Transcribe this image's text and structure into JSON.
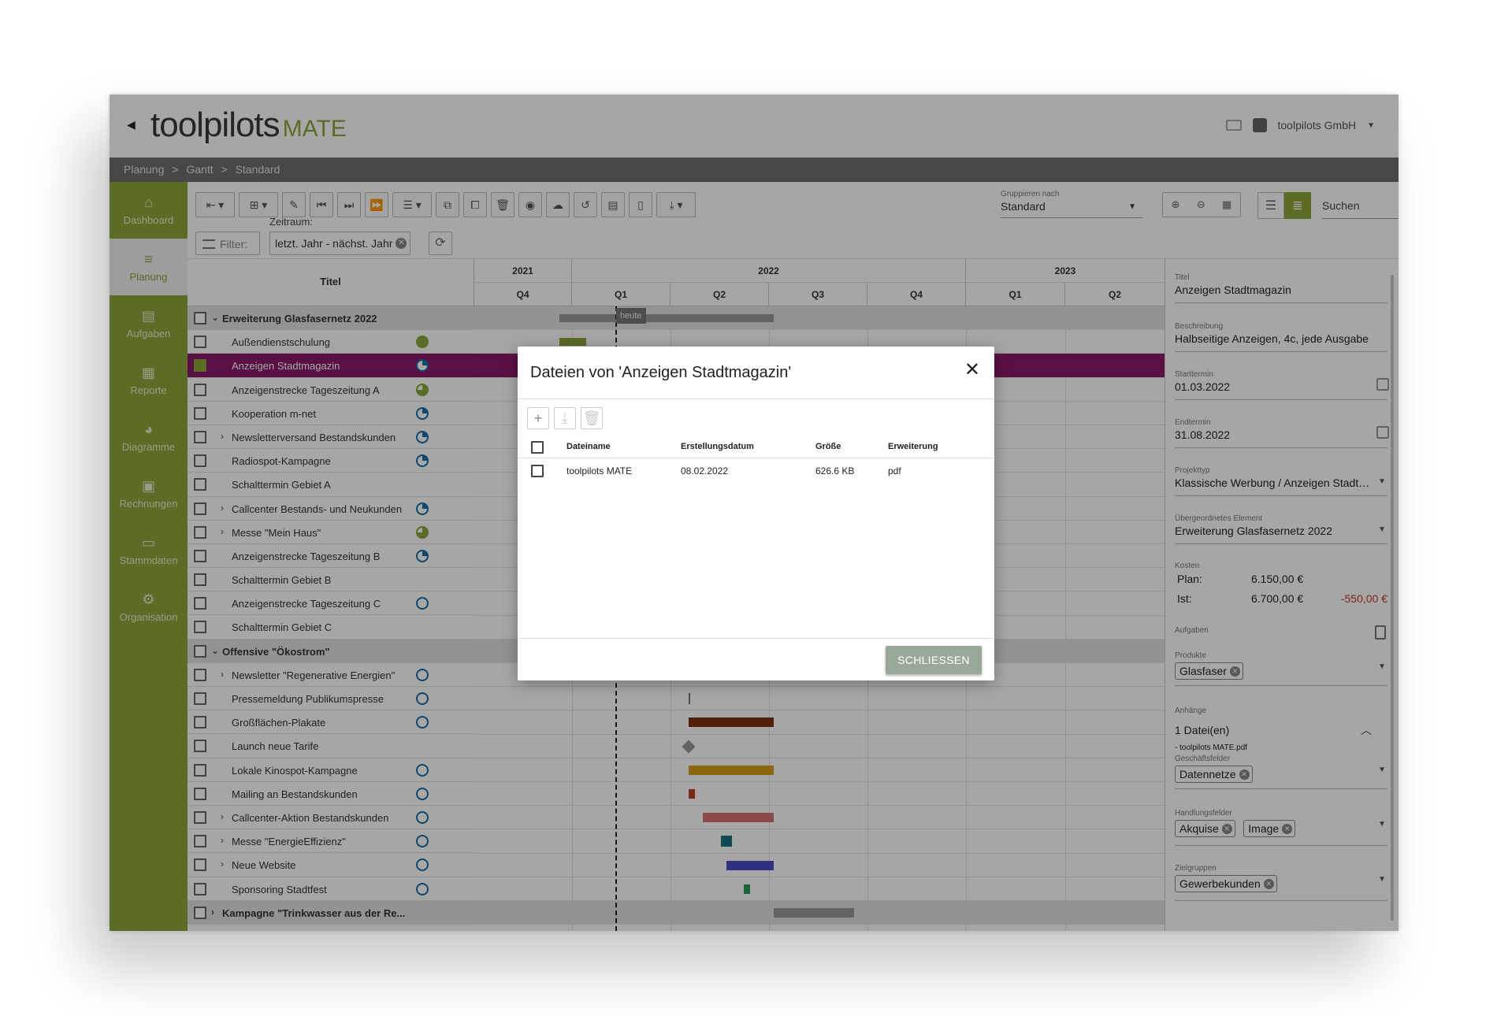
{
  "app": {
    "logo": "toolpilots",
    "logo_suffix": "MATE",
    "user": "toolpilots GmbH",
    "breadcrumb": [
      "Planung",
      "Gantt",
      "Standard"
    ],
    "breadcrumb_sep": ">"
  },
  "sidebar": {
    "items": [
      {
        "label": "Dashboard",
        "icon": "home-icon"
      },
      {
        "label": "Planung",
        "icon": "planning-icon",
        "active": true
      },
      {
        "label": "Aufgaben",
        "icon": "task-icon"
      },
      {
        "label": "Reporte",
        "icon": "report-icon"
      },
      {
        "label": "Diagramme",
        "icon": "pie-chart-icon"
      },
      {
        "label": "Rechnungen",
        "icon": "invoice-icon"
      },
      {
        "label": "Stammdaten",
        "icon": "masterdata-icon"
      },
      {
        "label": "Organisation",
        "icon": "organisation-icon"
      }
    ]
  },
  "toolbar": {
    "group_label": "Gruppieren nach",
    "group_value": "Standard",
    "search_placeholder": "Suchen",
    "filter_label": "Filter:",
    "zeitraum_label": "Zeitraum:",
    "zeitraum_value": "letzt. Jahr - nächst. Jahr"
  },
  "tree": {
    "header": "Titel",
    "rows": [
      {
        "label": "Erweiterung Glasfasernetz 2022",
        "type": "group"
      },
      {
        "label": "Außendienstschulung",
        "pie": "full"
      },
      {
        "label": "Anzeigen Stadtmagazin",
        "selected": true,
        "pie": "part"
      },
      {
        "label": "Anzeigenstrecke Tageszeitung A",
        "pie": "green"
      },
      {
        "label": "Kooperation m-net",
        "pie": "part"
      },
      {
        "label": "Newsletterversand Bestandskunden",
        "expand": true,
        "pie": "part"
      },
      {
        "label": "Radiospot-Kampagne",
        "pie": "part"
      },
      {
        "label": "Schalttermin Gebiet A"
      },
      {
        "label": "Callcenter Bestands- und Neukunden",
        "expand": true,
        "pie": "part"
      },
      {
        "label": "Messe \"Mein Haus\"",
        "expand": true,
        "pie": "green"
      },
      {
        "label": "Anzeigenstrecke Tageszeitung B",
        "pie": "part"
      },
      {
        "label": "Schalttermin Gebiet B"
      },
      {
        "label": "Anzeigenstrecke Tageszeitung C",
        "pie": "empty"
      },
      {
        "label": "Schalttermin Gebiet C"
      },
      {
        "label": "Offensive \"Ökostrom\"",
        "type": "group"
      },
      {
        "label": "Newsletter \"Regenerative Energien\"",
        "expand": true,
        "pie": "empty"
      },
      {
        "label": "Pressemeldung Publikumspresse",
        "pie": "empty"
      },
      {
        "label": "Großflächen-Plakate",
        "pie": "empty"
      },
      {
        "label": "Launch neue Tarife"
      },
      {
        "label": "Lokale Kinospot-Kampagne",
        "pie": "empty"
      },
      {
        "label": "Mailing an Bestandskunden",
        "pie": "empty"
      },
      {
        "label": "Callcenter-Aktion Bestandskunden",
        "expand": true,
        "pie": "empty"
      },
      {
        "label": "Messe \"EnergieEffizienz\"",
        "expand": true,
        "pie": "empty"
      },
      {
        "label": "Neue Website",
        "expand": true,
        "pie": "empty"
      },
      {
        "label": "Sponsoring Stadtfest",
        "pie": "empty"
      },
      {
        "label": "Kampagne \"Trinkwasser aus der Re...",
        "type": "group",
        "collapsed": true
      }
    ]
  },
  "gantt": {
    "years": [
      "2021",
      "2022",
      "2023"
    ],
    "quarters": [
      "Q4",
      "Q1",
      "Q2",
      "Q3",
      "Q4",
      "Q1",
      "Q2"
    ],
    "today_label": "heute"
  },
  "detail": {
    "titel_label": "Titel",
    "titel": "Anzeigen Stadtmagazin",
    "beschreibung_label": "Beschreibung",
    "beschreibung": "Halbseitige Anzeigen, 4c, jede Ausgabe",
    "start_label": "Starttermin",
    "start": "01.03.2022",
    "end_label": "Endtermin",
    "end": "31.08.2022",
    "projekttyp_label": "Projekttyp",
    "projekttyp": "Klassische Werbung / Anzeigen Stadt- ...",
    "parent_label": "Übergeordnetes Element",
    "parent": "Erweiterung Glasfasernetz 2022",
    "kosten_label": "Kosten",
    "plan_label": "Plan:",
    "plan": "6.150,00 €",
    "ist_label": "Ist:",
    "ist": "6.700,00 €",
    "diff": "-550,00 €",
    "aufgaben_label": "Aufgaben",
    "produkte_label": "Produkte",
    "produkte": [
      "Glasfaser"
    ],
    "anhaenge_label": "Anhänge",
    "anhaenge_count": "1 Datei(en)",
    "anhaenge_file": "- toolpilots MATE.pdf",
    "geschaeftsfelder_label": "Geschäftsfelder",
    "geschaeftsfelder": [
      "Datennetze"
    ],
    "handlungsfelder_label": "Handlungsfelder",
    "handlungsfelder": [
      "Akquise",
      "Image"
    ],
    "zielgruppen_label": "Zielgruppen",
    "zielgruppen": [
      "Gewerbekunden"
    ]
  },
  "modal": {
    "title": "Dateien von 'Anzeigen Stadtmagazin'",
    "columns": [
      "Dateiname",
      "Erstellungsdatum",
      "Größe",
      "Erweiterung"
    ],
    "files": [
      {
        "name": "toolpilots MATE",
        "date": "08.02.2022",
        "size": "626.6 KB",
        "ext": "pdf"
      }
    ],
    "close_button": "SCHLIESSEN"
  },
  "colors": {
    "brand_green": "#8aa63a",
    "selected_row": "#8d1a6a",
    "cost_negative": "#c0392b"
  }
}
